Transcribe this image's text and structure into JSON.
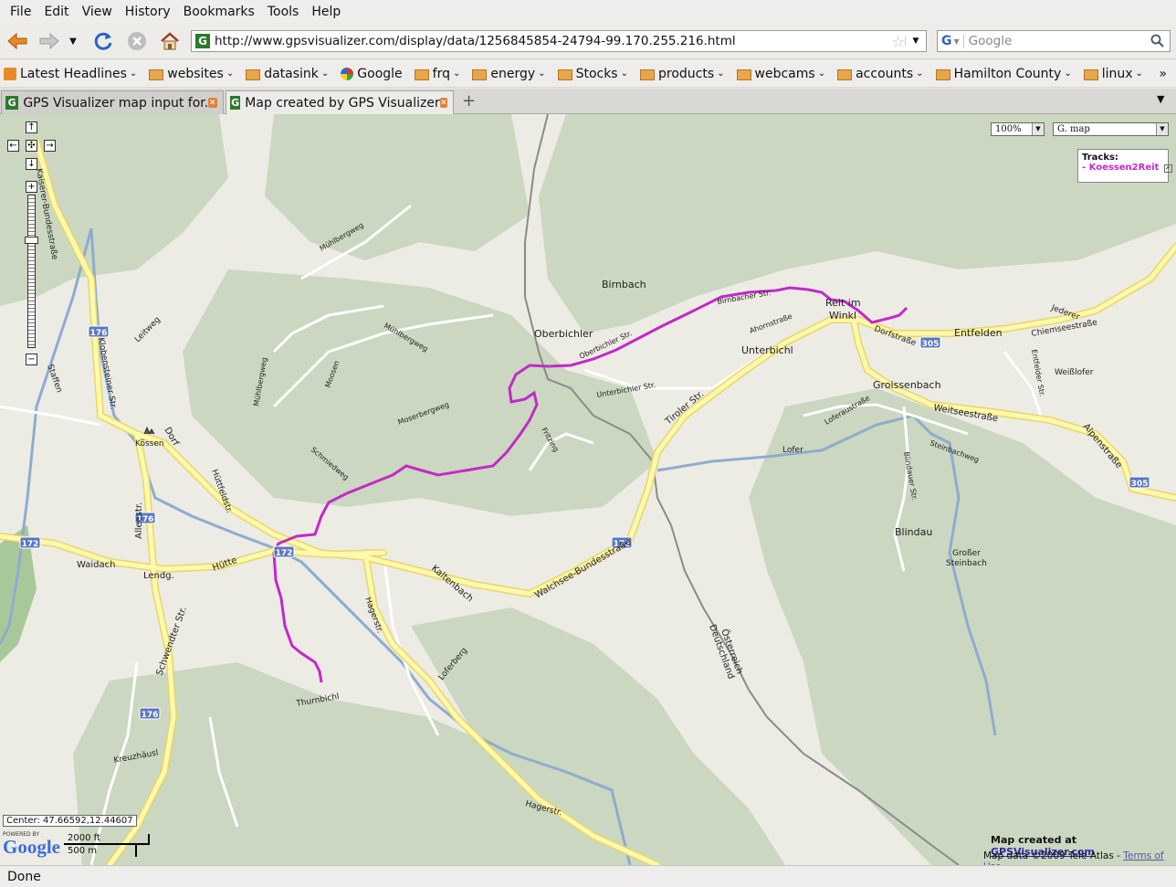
{
  "menu": [
    "File",
    "Edit",
    "View",
    "History",
    "Bookmarks",
    "Tools",
    "Help"
  ],
  "url": "http://www.gpsvisualizer.com/display/data/1256845854-24794-99.170.255.216.html",
  "search_placeholder": "Google",
  "bookmarks": [
    {
      "label": "Latest Headlines",
      "icon": "rss-icon"
    },
    {
      "label": "websites",
      "icon": "folder-icon"
    },
    {
      "label": "datasink",
      "icon": "folder-icon"
    },
    {
      "label": "Google",
      "icon": "google-icon"
    },
    {
      "label": "frq",
      "icon": "folder-icon"
    },
    {
      "label": "energy",
      "icon": "folder-icon"
    },
    {
      "label": "Stocks",
      "icon": "folder-icon"
    },
    {
      "label": "products",
      "icon": "folder-icon"
    },
    {
      "label": "webcams",
      "icon": "folder-icon"
    },
    {
      "label": "accounts",
      "icon": "folder-icon"
    },
    {
      "label": "Hamilton County",
      "icon": "folder-icon"
    },
    {
      "label": "linux",
      "icon": "folder-icon"
    }
  ],
  "tabs": [
    {
      "label": "GPS Visualizer map input for...",
      "active": false
    },
    {
      "label": "Map created by GPS Visualizer",
      "active": true
    }
  ],
  "map": {
    "zoom_value": "100%",
    "map_type": "G. map",
    "tracks_title": "Tracks:",
    "track_prefix": "- ",
    "track_name": "Koessen2Reit",
    "center_label": "Center: 47.66592,12.44607",
    "scale_ft": "2000 ft",
    "scale_m": "500 m",
    "powered_by": "POWERED BY",
    "google_logo": "Google",
    "credit_prefix": "Map created at ",
    "credit_link": "GPSVisualizer.com",
    "mapdata_text": "Map data ©2009 Tele Atlas - ",
    "terms_link": "Terms of Use",
    "labels": {
      "birnbach": "Birnbach",
      "oberbichler": "Oberbichler",
      "unterbichl": "Unterbichl",
      "reit1": "Reit im",
      "reit2": "Winkl",
      "entfelden": "Entfelden",
      "groissenbach": "Groissenbach",
      "weissloefer": "Weißlofer",
      "lofer": "Lofer",
      "blindau": "Blindau",
      "grosser1": "Großer",
      "grosser2": "Steinbach",
      "koessen": "Kössen",
      "dorf": "Dorf",
      "waidach": "Waidach",
      "lendg": "Lendg.",
      "huette": "Hütte",
      "kaltenbach": "Kaltenbach",
      "thurnbichl": "Thurnbichl",
      "kreuzhaeusl": "Kreuzhäusl",
      "jederer": "Jederer",
      "staffen": "Staffen",
      "leitweg": "Leitweg",
      "dorfstrasse": "Dorfstraße",
      "chiemseestrasse": "Chiemseestraße",
      "weitseestrasse": "Weitseestraße",
      "alpenstrasse": "Alpenstraße",
      "tirolerstr": "Tiroler Str.",
      "walchsee": "Walchsee-Bundesstraße",
      "hagerstr": "Hagerstr.",
      "hagerstr2": "Hagerstr.",
      "loferberg": "Loferberg",
      "moserberg": "Moserbergweg",
      "muehlberg": "Mühlbergweg",
      "muehlberg2": "Mühlbergweg",
      "muehlberg3": "Mühlbergweg",
      "moosen": "Moosen",
      "schmiedweg": "Schmiedweg",
      "fritzing": "Fritzing",
      "unterbichler": "Unterbichler Str.",
      "oberbichlerstr": "Oberbichler Str.",
      "birnbacherstr": "Birnbacher Str.",
      "ahornstr": "Ahornstraße",
      "loferaustr": "Loferaustraße",
      "steinbachweg": "Steinbachweg",
      "blindauer": "Blindauer Str.",
      "entfelder": "Entfelder Str.",
      "alleestr": "Alleestr.",
      "schwendter": "Schwendter Str.",
      "kobenstein": "Klobensteiner Str.",
      "huettfeld": "Hüttfeldstr.",
      "deutschland": "Deutschland",
      "oesterreich": "Österreich",
      "bundesstrasse": "Kaiserer-Bundesstraße",
      "r176a": "176",
      "r176b": "176",
      "r176c": "176",
      "r172a": "172",
      "r172b": "172",
      "r172c": "172",
      "r305a": "305",
      "r305b": "305"
    }
  },
  "status": "Done"
}
